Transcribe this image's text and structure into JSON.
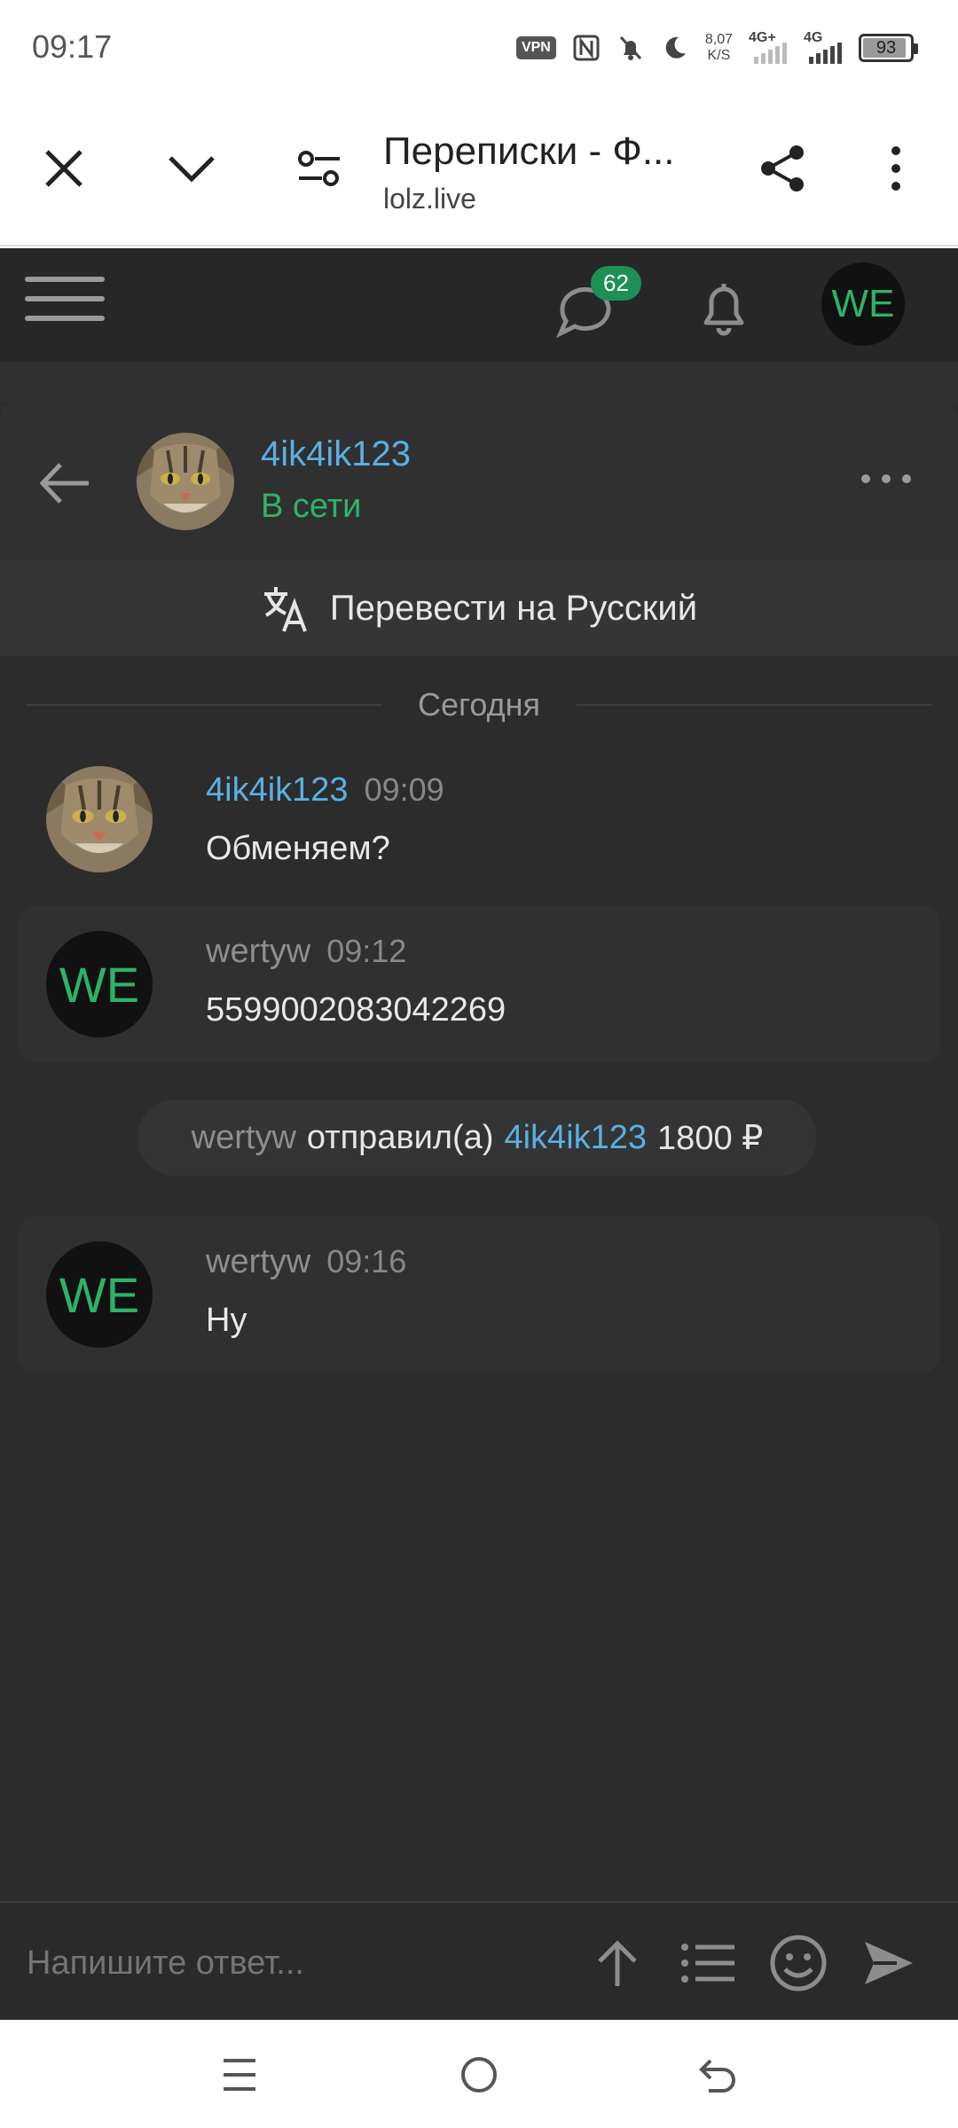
{
  "status_bar": {
    "time": "09:17",
    "vpn": "VPN",
    "net_speed_value": "8,07",
    "net_speed_unit": "K/S",
    "signal1": "4G+",
    "signal2": "4G",
    "battery": "93",
    "battery_level": 0.93
  },
  "browser": {
    "title": "Переписки - Ф...",
    "url": "lolz.live",
    "icons": [
      "close-icon",
      "chevron-down-icon",
      "tune-icon",
      "share-icon",
      "more-vertical-icon"
    ]
  },
  "site_header": {
    "messages_badge": "62",
    "avatar_initials": "WE"
  },
  "conversation": {
    "peer_name": "4ik4ik123",
    "peer_status": "В сети",
    "translate_label": "Перевести на Русский",
    "date_divider": "Сегодня",
    "messages": [
      {
        "author": "4ik4ik123",
        "time": "09:09",
        "text": "Обменяем?",
        "own": false
      },
      {
        "author": "wertyw",
        "time": "09:12",
        "text": "5599002083042269",
        "own": true,
        "avatar": "WE"
      },
      {
        "author": "wertyw",
        "time": "09:16",
        "text": "Ну",
        "own": true,
        "avatar": "WE"
      }
    ],
    "system_message": {
      "from": "wertyw",
      "verb": "отправил(а)",
      "to": "4ik4ik123",
      "amount": "1800 ₽"
    }
  },
  "reply": {
    "placeholder": "Напишите ответ..."
  },
  "colors": {
    "accent_blue": "#5ab0e3",
    "online_green": "#2fb36b",
    "badge_green": "#1f8f55",
    "background": "#2c2c2c"
  }
}
